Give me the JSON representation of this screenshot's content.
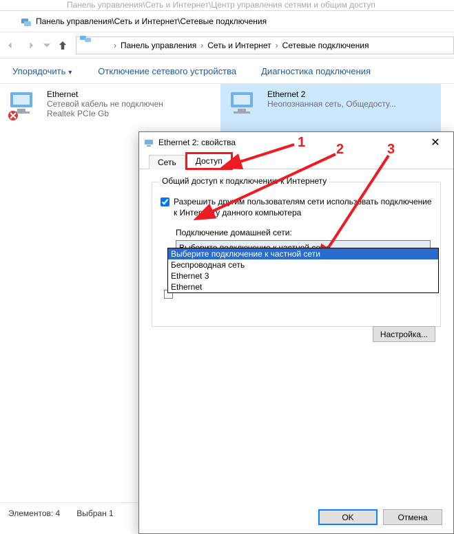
{
  "bg_title": "Панель управления\\Сеть и Интернет\\Центр управления сетями и общим доступ",
  "window_title": "Панель управления\\Сеть и Интернет\\Сетевые подключения",
  "breadcrumb": {
    "a": "Панель управления",
    "b": "Сеть и Интернет",
    "c": "Сетевые подключения"
  },
  "toolbar": {
    "organize": "Упорядочить",
    "disable": "Отключение сетевого устройства",
    "diagnose": "Диагностика подключения"
  },
  "connections": {
    "eth": {
      "name": "Ethernet",
      "status": "Сетевой кабель не подключен",
      "device": "Realtek PCIe Gb"
    },
    "eth2": {
      "name": "Ethernet 2",
      "status": "Неопознанная сеть, Общедосту..."
    }
  },
  "status_bar": {
    "elements": "Элементов: 4",
    "selected": "Выбран 1"
  },
  "dialog": {
    "title": "Ethernet 2: свойства",
    "tab_network": "Сеть",
    "tab_sharing": "Доступ",
    "group_legend": "Общий доступ к подключению к Интернету",
    "allow_label": "Разрешить другим пользователям сети использовать подключение к Интернету данного компьютера",
    "home_net_label": "Подключение домашней сети:",
    "combo_value": "Выберите подключение к частной сети",
    "options": {
      "o0": "Выберите подключение к частной сети",
      "o1": "Беспроводная сеть",
      "o2": "Ethernet 3",
      "o3": "Ethernet"
    },
    "settings_btn": "Настройка...",
    "ok": "OK",
    "cancel": "Отмена"
  },
  "annotations": {
    "n1": "1",
    "n2": "2",
    "n3": "3"
  }
}
